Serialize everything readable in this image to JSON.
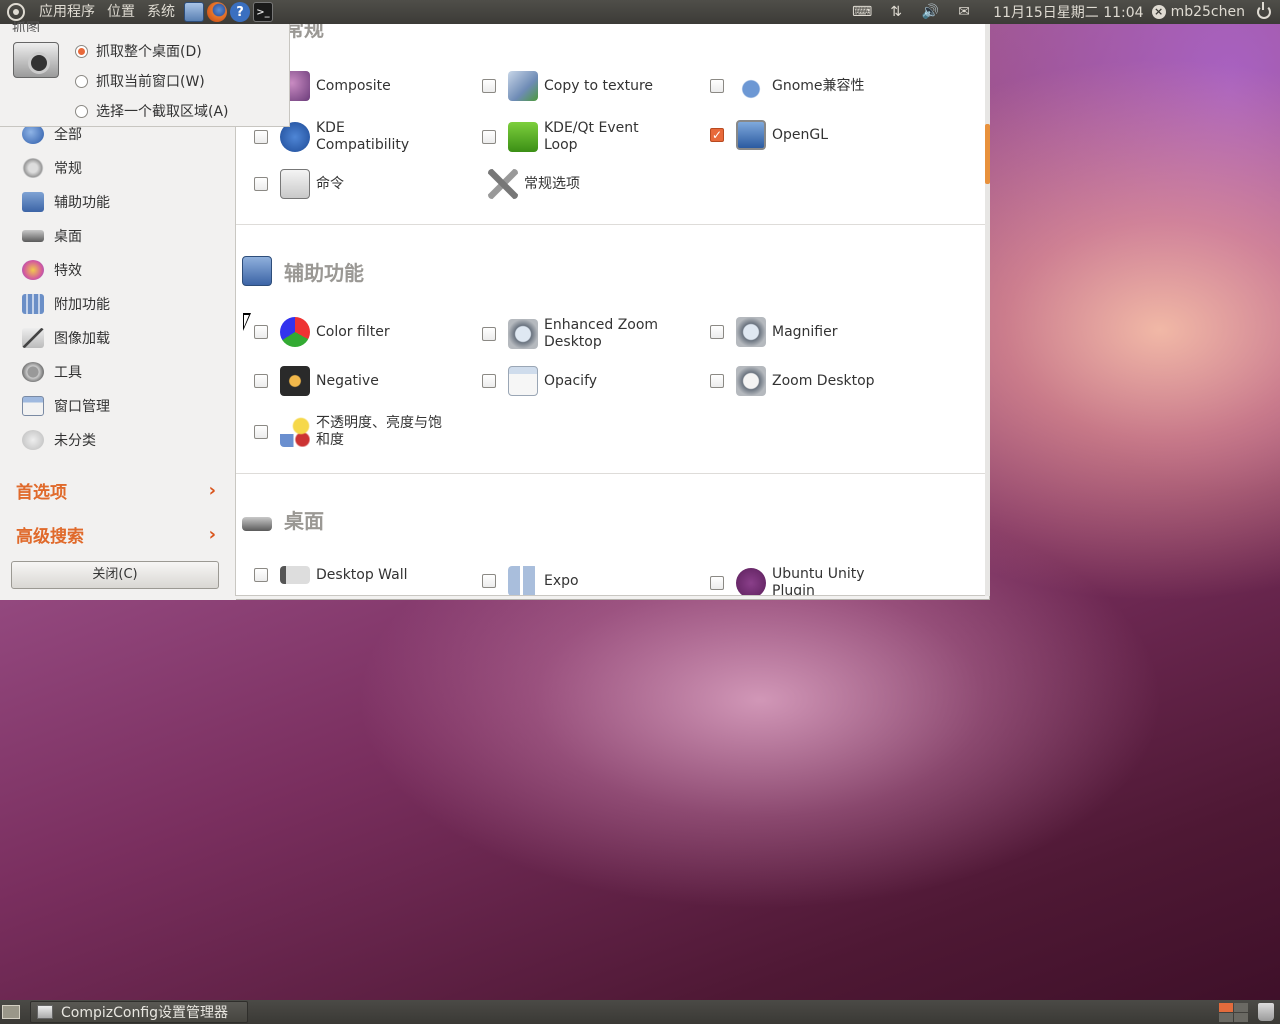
{
  "top_panel": {
    "menus": [
      "应用程序",
      "位置",
      "系统"
    ],
    "clock": "11月15日星期二 11:04",
    "user": "mb25chen",
    "launchers": [
      "desktop-icon",
      "firefox-icon",
      "help-icon",
      "terminal-icon"
    ],
    "tray": [
      "keyboard-icon",
      "network-icon",
      "volume-icon",
      "mail-icon"
    ]
  },
  "bottom_panel": {
    "task_label": "CompizConfig设置管理器",
    "accent_color": "#e36b3c"
  },
  "screenshot_popup": {
    "title": "抓图",
    "options": [
      {
        "label": "抓取整个桌面(D)",
        "checked": true
      },
      {
        "label": "抓取当前窗口(W)",
        "checked": false
      },
      {
        "label": "选择一个截取区域(A)",
        "checked": false
      }
    ]
  },
  "sidebar": {
    "categories": [
      "全部",
      "常规",
      "辅助功能",
      "桌面",
      "特效",
      "附加功能",
      "图像加载",
      "工具",
      "窗口管理",
      "未分类"
    ],
    "preferences_label": "首选项",
    "advanced_search_label": "高级搜索",
    "close_label": "关闭(C)"
  },
  "sections": {
    "general": {
      "title": "常规",
      "plugins": [
        {
          "label": "Composite",
          "checked": null
        },
        {
          "label": "Copy to texture",
          "checked": false
        },
        {
          "label": "Gnome兼容性",
          "checked": false
        },
        {
          "label": "KDE Compatibility",
          "checked": false
        },
        {
          "label": "KDE/Qt Event Loop",
          "checked": false
        },
        {
          "label": "OpenGL",
          "checked": true
        },
        {
          "label": "命令",
          "checked": false
        },
        {
          "label": "常规选项",
          "checked": null
        }
      ]
    },
    "accessibility": {
      "title": "辅助功能",
      "plugins": [
        {
          "label": "Color filter",
          "checked": false
        },
        {
          "label": "Enhanced Zoom Desktop",
          "checked": false
        },
        {
          "label": "Magnifier",
          "checked": false
        },
        {
          "label": "Negative",
          "checked": false
        },
        {
          "label": "Opacify",
          "checked": false
        },
        {
          "label": "Zoom Desktop",
          "checked": false
        },
        {
          "label": "不透明度、亮度与饱和度",
          "checked": false
        }
      ]
    },
    "desktop": {
      "title": "桌面",
      "plugins": [
        {
          "label": "Desktop Wall",
          "checked": false
        },
        {
          "label": "Expo",
          "checked": false
        },
        {
          "label": "Ubuntu Unity Plugin",
          "checked": false
        }
      ]
    }
  }
}
